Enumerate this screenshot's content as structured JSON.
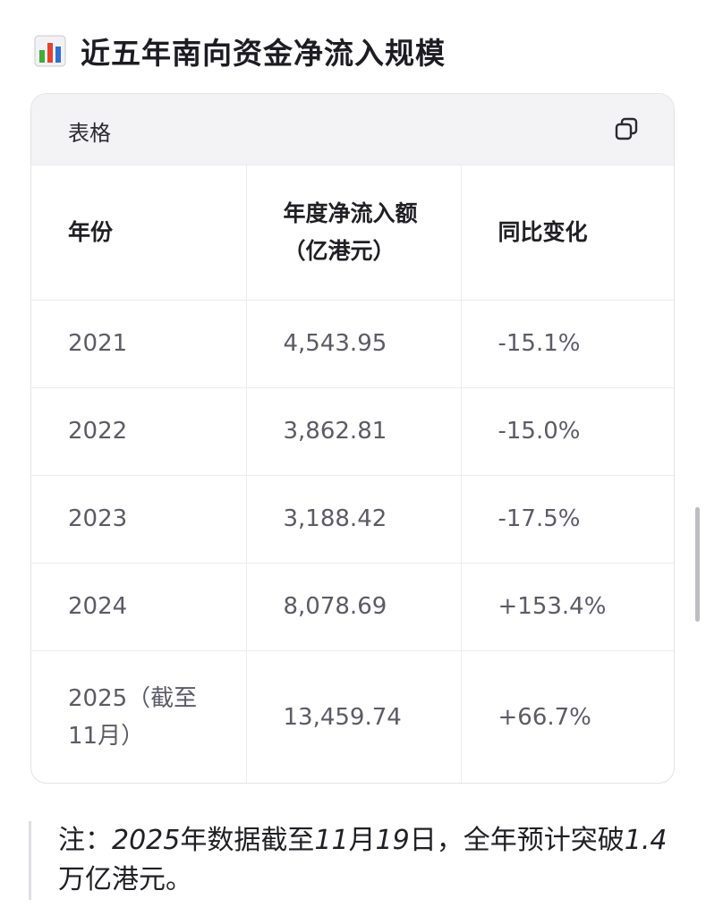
{
  "heading": {
    "icon": "bar-chart-icon",
    "title": "近五年南向资金净流入规模"
  },
  "table": {
    "card_title": "表格",
    "copy_icon": "copy-icon",
    "headers": [
      "年份",
      "年度净流入额（亿港元）",
      "同比变化"
    ],
    "rows": [
      [
        "2021",
        "4,543.95",
        "-15.1%"
      ],
      [
        "2022",
        "3,862.81",
        "-15.0%"
      ],
      [
        "2023",
        "3,188.42",
        "-17.5%"
      ],
      [
        "2024",
        "8,078.69",
        "+153.4%"
      ],
      [
        "2025（截至11月）",
        "13,459.74",
        "+66.7%"
      ]
    ]
  },
  "note": {
    "prefix": "注：",
    "year": "2025",
    "text_1": "年数据截至",
    "month": "11",
    "text_2": "月",
    "day": "19",
    "text_3": "日，全年预计突破",
    "amount": "1.4",
    "text_4": "万亿港元。"
  },
  "colors": {
    "chart_icon_red": "#e8412c",
    "chart_icon_green": "#3fae3a",
    "chart_icon_blue": "#2f6fd6",
    "header_bg": "#f3f3f5",
    "border": "#e3e3e8"
  }
}
